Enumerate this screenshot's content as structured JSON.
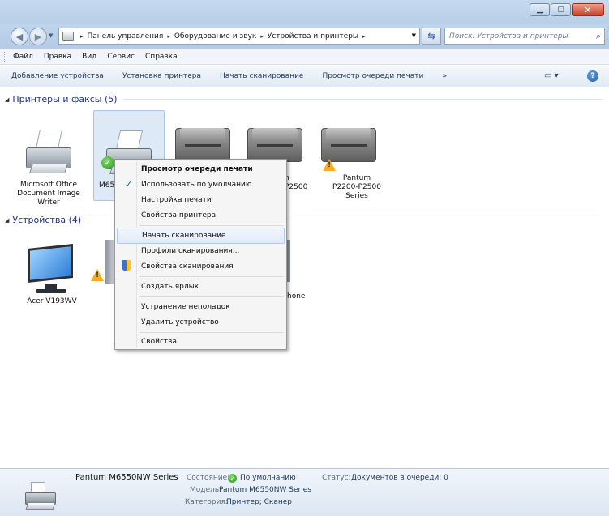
{
  "window": {
    "minimize_glyph": "▁",
    "maximize_glyph": "▢",
    "close_glyph": "✕"
  },
  "address": {
    "crumbs": [
      "Панель управления",
      "Оборудование и звук",
      "Устройства и принтеры"
    ],
    "separator": "▸",
    "search_placeholder": "Поиск: Устройства и принтеры"
  },
  "menu": {
    "items": [
      "Файл",
      "Правка",
      "Вид",
      "Сервис",
      "Справка"
    ]
  },
  "commands": {
    "items": [
      "Добавление устройства",
      "Установка принтера",
      "Начать сканирование",
      "Просмотр очереди печати"
    ],
    "more": "»"
  },
  "groups": {
    "printers_title": "Принтеры и факсы (5)",
    "devices_title": "Устройства (4)"
  },
  "printers": [
    {
      "label": "Microsoft Office Document Image Writer"
    },
    {
      "label": "M65"
    },
    {
      "label": ""
    },
    {
      "label": "n\nP2500"
    },
    {
      "label": "Pantum P2200-P2500 Series"
    }
  ],
  "devices": [
    {
      "label": "Acer V193WV"
    },
    {
      "label": "hone"
    }
  ],
  "context_menu": {
    "items": [
      {
        "label": "Просмотр очереди печати"
      },
      {
        "label": "Использовать по умолчанию"
      },
      {
        "label": "Настройка печати"
      },
      {
        "label": "Свойства принтера"
      },
      {
        "label": "Начать сканирование"
      },
      {
        "label": "Профили сканирования..."
      },
      {
        "label": "Свойства сканирования"
      },
      {
        "label": "Создать ярлык"
      },
      {
        "label": "Устранение неполадок"
      },
      {
        "label": "Удалить устройство"
      },
      {
        "label": "Свойства"
      }
    ]
  },
  "details": {
    "name": "Pantum M6550NW Series",
    "state_key": "Состояние:",
    "state_value": "По умолчанию",
    "status_key": "Статус:",
    "status_value": "Документов в очереди: 0",
    "model_key": "Модель:",
    "model_value": "Pantum M6550NW Series",
    "category_key": "Категория:",
    "category_value": "Принтер; Сканер"
  }
}
